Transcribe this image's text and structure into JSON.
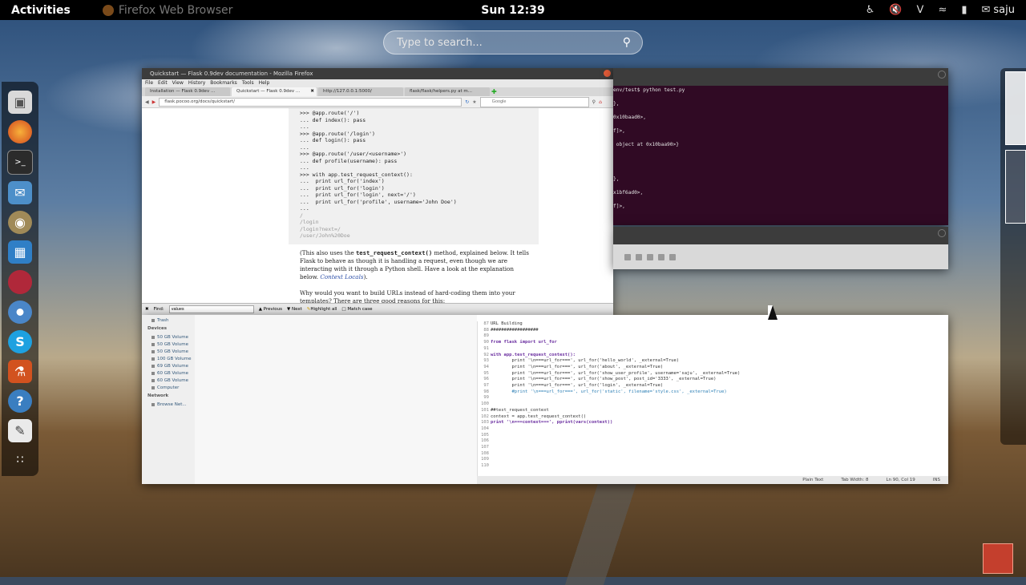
{
  "topbar": {
    "activities": "Activities",
    "app_name": "Firefox Web Browser",
    "clock": "Sun 12:39",
    "user": "saju",
    "tray_icons": [
      "accessibility-icon",
      "volume-muted-icon",
      "bluetooth-icon",
      "wifi-icon",
      "battery-icon",
      "user-icon"
    ]
  },
  "search": {
    "placeholder": "Type to search..."
  },
  "dash": {
    "apps": [
      "files-icon",
      "firefox-icon",
      "terminal-icon",
      "chat-icon",
      "camera-icon",
      "screenshot-icon",
      "app-red-icon",
      "chromium-icon",
      "skype-icon",
      "software-center-icon",
      "help-icon",
      "text-editor-icon",
      "show-apps-icon"
    ]
  },
  "firefox": {
    "title": "Quickstart — Flask 0.9dev documentation - Mozilla Firefox",
    "menus": [
      "File",
      "Edit",
      "View",
      "History",
      "Bookmarks",
      "Tools",
      "Help"
    ],
    "tabs": [
      {
        "label": "Installation — Flask 0.9dev ..."
      },
      {
        "label": "Quickstart — Flask 0.9dev ..."
      },
      {
        "label": "http://127.0.0.1:5000/"
      },
      {
        "label": "flask/flask/helpers.py at m..."
      }
    ],
    "url": "flask.pocoo.org/docs/quickstart/",
    "search_placeholder": "Google",
    "code_lines": [
      ">>> @app.route('/')",
      "... def index(): pass",
      "...",
      ">>> @app.route('/login')",
      "... def login(): pass",
      "...",
      ">>> @app.route('/user/<username>')",
      "... def profile(username): pass",
      "...",
      ">>> with app.test_request_context():",
      "...  print url_for('index')",
      "...  print url_for('login')",
      "...  print url_for('login', next='/')",
      "...  print url_for('profile', username='John Doe')",
      "...",
      "/",
      "/login",
      "/login?next=/",
      "/user/John%20Doe"
    ],
    "para1_pre": "(This also uses the ",
    "para1_code": "test_request_context()",
    "para1_post": " method, explained below. It tells Flask to behave as though it is handling a request, even though we are interacting with it through a Python shell. Have a look at the explanation below. ",
    "para1_link": "Context Locals",
    "para1_end": ").",
    "para2": "Why would you want to build URLs instead of hard-coding them into your templates? There are three good reasons for this:",
    "find_label": "Find:",
    "find_value": "values",
    "find_previous": "Previous",
    "find_next": "Next",
    "find_highlight": "Highlight all",
    "find_match_case": "Match case"
  },
  "terminal": {
    "lines": [
      "env/test$ python test.py",
      "",
      "},",
      "",
      "0x10baad0>,",
      "",
      "f]>,",
      "",
      " object at 0x10baa90>}",
      "",
      "",
      "",
      "",
      "},",
      "",
      "x1bf6ad0>,",
      "",
      "f]>,"
    ]
  },
  "files_sidebar": {
    "trash": "Trash",
    "devices_header": "Devices",
    "devices": [
      "50 GB Volume",
      "50 GB Volume",
      "50 GB Volume",
      "100 GB Volume",
      "69 GB Volume",
      "60 GB Volume",
      "60 GB Volume",
      "Computer"
    ],
    "network_header": "Network",
    "network": [
      "Browse Net..."
    ]
  },
  "editor": {
    "lines": [
      {
        "n": "87",
        "t": "URL Building"
      },
      {
        "n": "88",
        "t": "##################"
      },
      {
        "n": "89",
        "t": ""
      },
      {
        "n": "90",
        "t": "from flask import url_for"
      },
      {
        "n": "91",
        "t": ""
      },
      {
        "n": "92",
        "t": "with app.test_request_context():"
      },
      {
        "n": "93",
        "t": "        print '\\n===url_for===', url_for('hello_world', _external=True)"
      },
      {
        "n": "94",
        "t": "        print '\\n===url_for===', url_for('about', _external=True)"
      },
      {
        "n": "95",
        "t": "        print '\\n===url_for===', url_for('show_user_profile', username='saju', _external=True)"
      },
      {
        "n": "96",
        "t": "        print '\\n===url_for===', url_for('show_post', post_id='3333', _external=True)"
      },
      {
        "n": "97",
        "t": "        print '\\n===url_for===', url_for('login', _external=True)"
      },
      {
        "n": "98",
        "t": "        #print '\\n===url_for===', url_for('static', filename='style.css', _external=True)"
      },
      {
        "n": "99",
        "t": ""
      },
      {
        "n": "100",
        "t": ""
      },
      {
        "n": "101",
        "t": "##test_request_context"
      },
      {
        "n": "102",
        "t": "context = app.test_request_context()"
      },
      {
        "n": "103",
        "t": "print '\\n===context===', pprint(vars(context))"
      },
      {
        "n": "104",
        "t": ""
      },
      {
        "n": "105",
        "t": ""
      },
      {
        "n": "106",
        "t": ""
      },
      {
        "n": "107",
        "t": ""
      },
      {
        "n": "108",
        "t": ""
      },
      {
        "n": "109",
        "t": ""
      },
      {
        "n": "110",
        "t": ""
      }
    ],
    "status_lang": "Plain Text",
    "status_tab": "Tab Width: 8",
    "status_pos": "Ln 90, Col 19",
    "status_ins": "INS"
  }
}
